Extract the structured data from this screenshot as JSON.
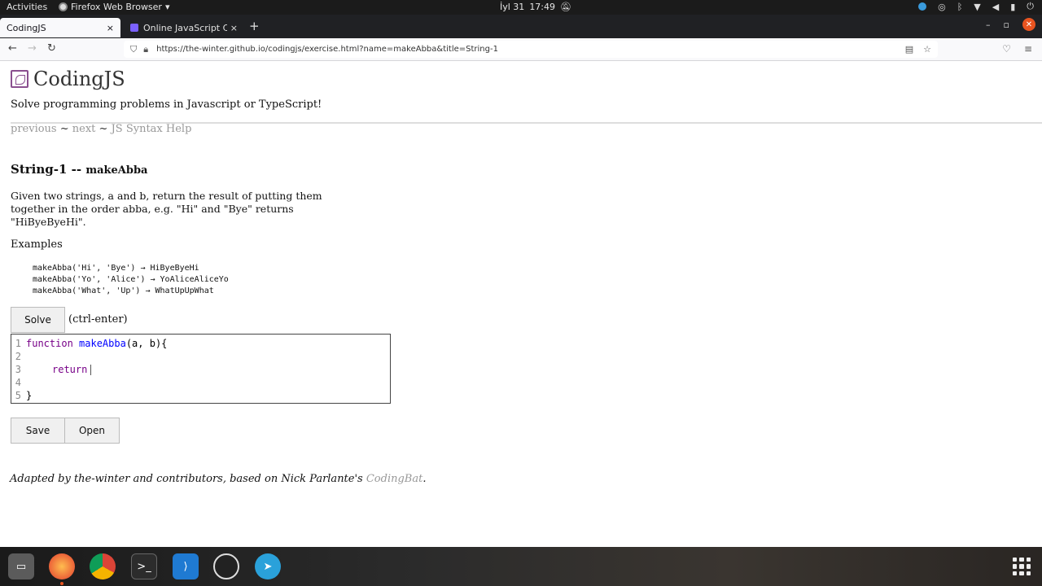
{
  "system": {
    "activities": "Activities",
    "app_menu": "Firefox Web Browser",
    "date": "İyl 31",
    "time": "17:49"
  },
  "tabs": [
    {
      "title": "CodingJS",
      "close": "×"
    },
    {
      "title": "Online JavaScript Compil",
      "close": "×"
    }
  ],
  "new_tab": "+",
  "window_controls": {
    "minimize": "–",
    "maximize": "▫",
    "close": "✕"
  },
  "nav": {
    "back": "←",
    "forward": "→",
    "reload": "↻",
    "url": "https://the-winter.github.io/codingjs/exercise.html?name=makeAbba&title=String-1"
  },
  "page": {
    "site_title": "CodingJS",
    "tagline": "Solve programming problems in Javascript or TypeScript!",
    "links": {
      "previous": "previous",
      "sep1": " ~ ",
      "next": "next",
      "sep2": " ~ ",
      "help": "JS Syntax Help"
    },
    "problem": {
      "category": "String-1 -- ",
      "name": "makeAbba"
    },
    "description": "Given two strings, a and b, return the result of putting them together in the order abba, e.g. \"Hi\" and \"Bye\" returns \"HiByeByeHi\".",
    "examples_label": "Examples",
    "examples": [
      "makeAbba('Hi', 'Bye') → HiByeByeHi",
      "makeAbba('Yo', 'Alice') → YoAliceAliceYo",
      "makeAbba('What', 'Up') → WhatUpUpWhat"
    ],
    "solve_label": "Solve",
    "shortcut": "(ctrl-enter)",
    "editor": {
      "line_numbers": [
        "1",
        "2",
        "3",
        "4",
        "5"
      ],
      "kw_function": "function",
      "fn_name": "makeAbba",
      "params": "(a, b){",
      "kw_return": "return",
      "closing": "}"
    },
    "save_label": "Save",
    "open_label": "Open",
    "footer_text": "Adapted by the-winter and contributors, based on Nick Parlante's ",
    "footer_link": "CodingBat",
    "footer_end": "."
  }
}
